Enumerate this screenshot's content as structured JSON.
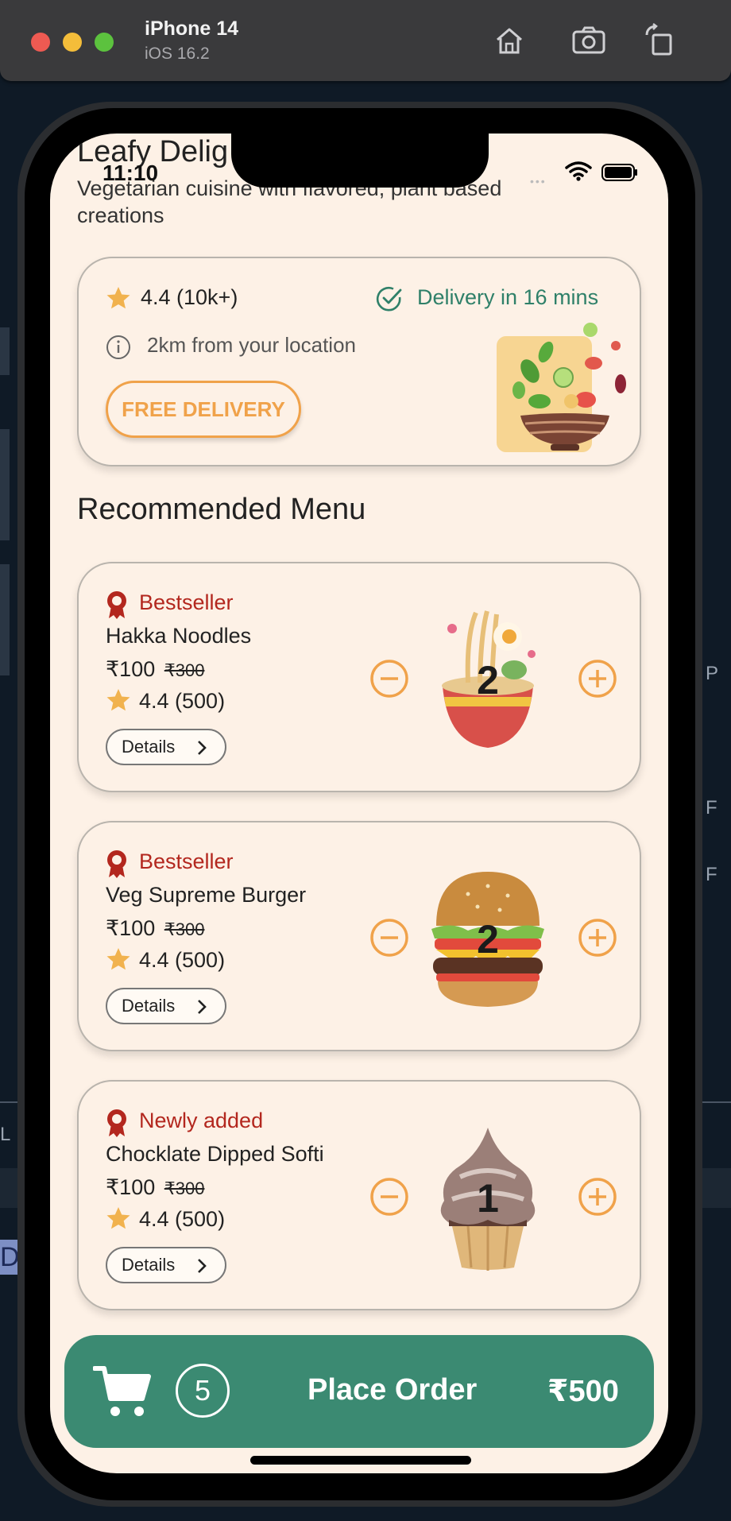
{
  "simulator": {
    "device_name": "iPhone 14",
    "os_version": "iOS 16.2",
    "buttons": [
      "home-icon",
      "screenshot-icon",
      "rotate-icon"
    ]
  },
  "status_bar": {
    "time": "11:10",
    "dots": "•••"
  },
  "restaurant": {
    "name": "Leafy Delig",
    "tagline": "Vegetarian cuisine with flavored, plant based creations",
    "rating": "4.4 (10k+)",
    "delivery_time": "Delivery in 16 mins",
    "distance": "2km from your location",
    "free_delivery": "FREE DELIVERY"
  },
  "section_title": "Recommended Menu",
  "menu": [
    {
      "badge": "Bestseller",
      "name": "Hakka Noodles",
      "price": "₹100",
      "old_price": "₹300",
      "rating": "4.4 (500)",
      "details": "Details",
      "quantity": "2",
      "image": "noodles-bowl"
    },
    {
      "badge": "Bestseller",
      "name": "Veg Supreme Burger",
      "price": "₹100",
      "old_price": "₹300",
      "rating": "4.4 (500)",
      "details": "Details",
      "quantity": "2",
      "image": "burger"
    },
    {
      "badge": "Newly added",
      "name": "Chocklate Dipped Softi",
      "price": "₹100",
      "old_price": "₹300",
      "rating": "4.4 (500)",
      "details": "Details",
      "quantity": "1",
      "image": "softy-cone"
    }
  ],
  "order": {
    "cart_count": "5",
    "label": "Place Order",
    "total": "₹500"
  },
  "background_fragments": {
    "right_1": "P",
    "right_2": "F",
    "right_3": "F",
    "left_1": "L",
    "left_2": "D"
  },
  "colors": {
    "accent_orange": "#f0a24a",
    "primary_green": "#3b8a72",
    "badge_red": "#b3271e",
    "screen_bg": "#fdf1e6"
  }
}
